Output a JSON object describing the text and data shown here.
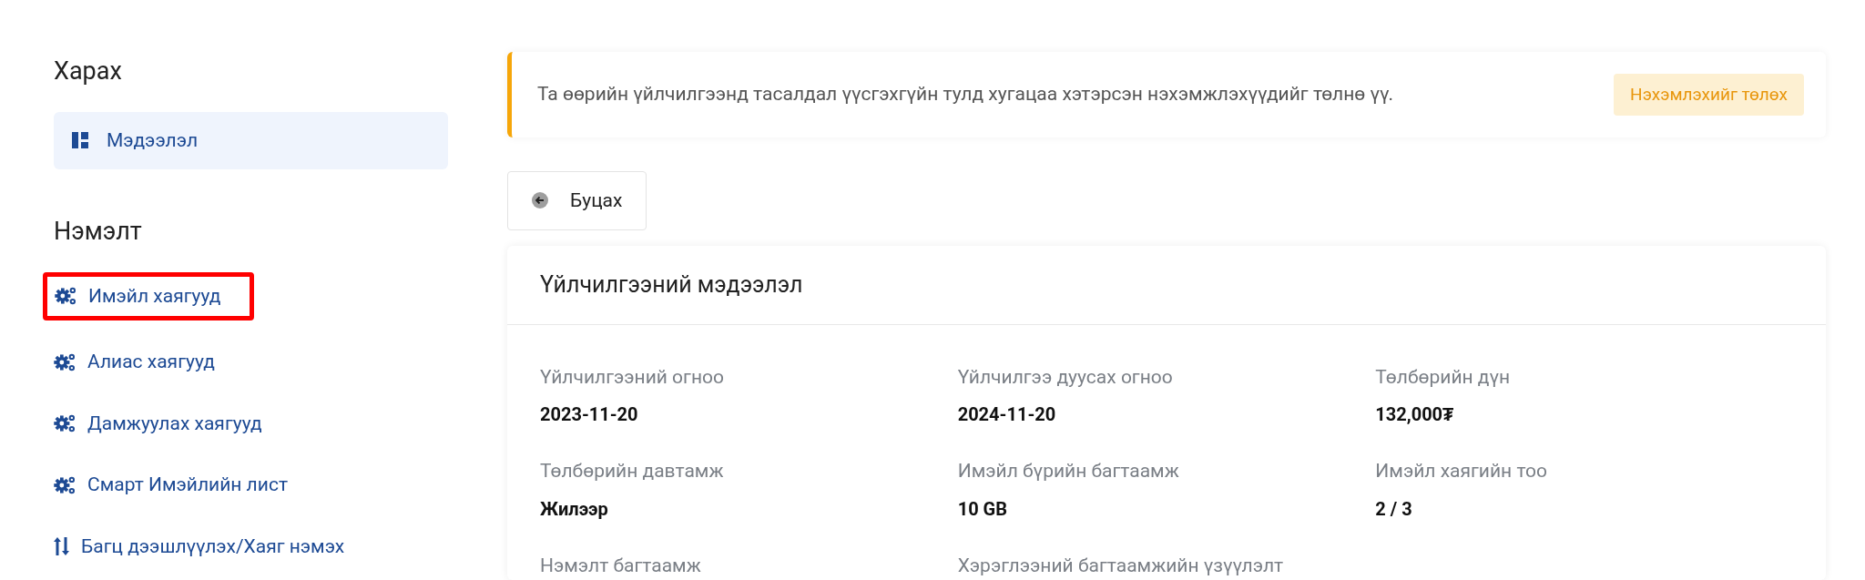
{
  "sidebar": {
    "sections": [
      {
        "title": "Харах",
        "items": [
          {
            "label": "Мэдээлэл",
            "kind": "dashboard",
            "selected": true,
            "highlighted": false
          }
        ]
      },
      {
        "title": "Нэмэлт",
        "items": [
          {
            "label": "Имэйл хаягууд",
            "kind": "gears",
            "selected": false,
            "highlighted": true
          },
          {
            "label": "Алиас хаягууд",
            "kind": "gears",
            "selected": false,
            "highlighted": false
          },
          {
            "label": "Дамжуулах хаягууд",
            "kind": "gears",
            "selected": false,
            "highlighted": false
          },
          {
            "label": "Смарт Имэйлийн лист",
            "kind": "gears",
            "selected": false,
            "highlighted": false
          },
          {
            "label": "Багц дээшлүүлэх/Хаяг нэмэх",
            "kind": "sort",
            "selected": false,
            "highlighted": false
          }
        ]
      }
    ]
  },
  "alert": {
    "message": "Та өөрийн үйлчилгээнд тасалдал үүсгэхгүйн тулд хугацаа хэтэрсэн нэхэмжлэхүүдийг төлнө үү.",
    "action": "Нэхэмлэхийг төлөх"
  },
  "back_button": "Буцах",
  "card": {
    "title": "Үйлчилгээний мэдээлэл",
    "fields": [
      {
        "label": "Үйлчилгээний огноо",
        "value": "2023-11-20"
      },
      {
        "label": "Үйлчилгээ дуусах огноо",
        "value": "2024-11-20"
      },
      {
        "label": "Төлбөрийн дүн",
        "value": "132,000₮"
      },
      {
        "label": "Төлбөрийн давтамж",
        "value": "Жилээр"
      },
      {
        "label": "Имэйл бүрийн багтаамж",
        "value": "10 GB"
      },
      {
        "label": "Имэйл хаягийн тоо",
        "value": "2 / 3"
      },
      {
        "label": "Нэмэлт багтаамж"
      },
      {
        "label": "Хэрэглээний багтаамжийн үзүүлэлт"
      }
    ]
  }
}
